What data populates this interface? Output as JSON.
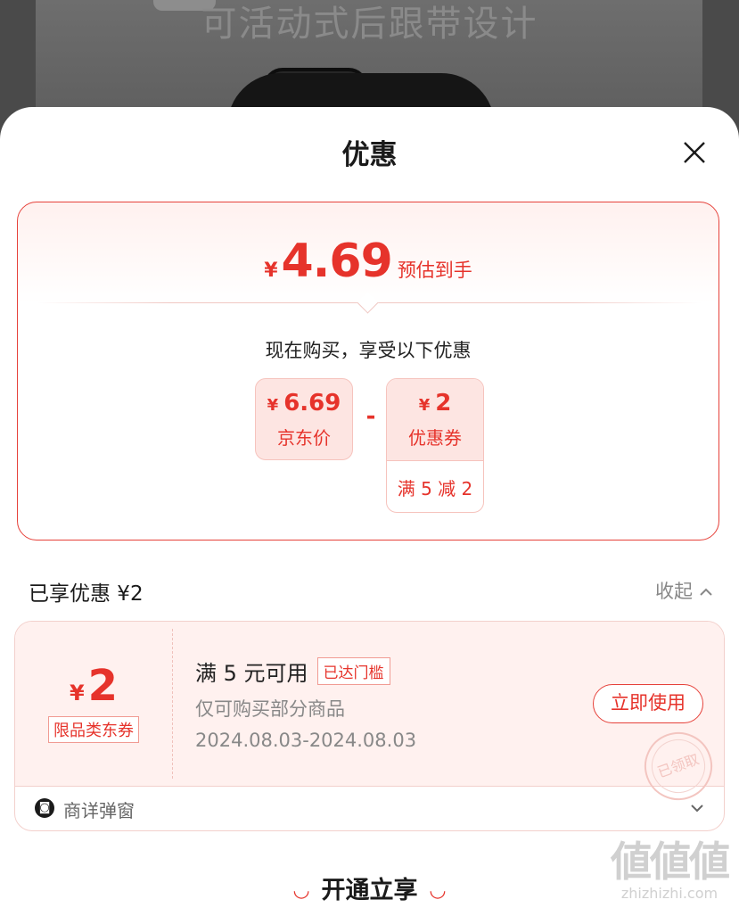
{
  "background": {
    "caption": "可活动式后跟带设计"
  },
  "sheet": {
    "title": "优惠",
    "close_icon": "close-icon"
  },
  "summary": {
    "currency": "¥",
    "estimated_price": "4.69",
    "estimated_label": "预估到手",
    "buy_text": "现在购买，享受以下优惠",
    "price_box": {
      "currency": "¥",
      "value": "6.69",
      "label": "京东价"
    },
    "operator": "-",
    "coupon_box": {
      "currency": "¥",
      "value": "2",
      "label": "优惠券",
      "condition": "满 5 减 2"
    }
  },
  "enjoyed": {
    "title": "已享优惠 ¥2",
    "collapse_label": "收起",
    "collapse_icon": "chevron-up-icon"
  },
  "coupon": {
    "currency": "¥",
    "value": "2",
    "tag": "限品类东券",
    "condition": "满 5 元可用",
    "badge": "已达门槛",
    "scope": "仅可购买部分商品",
    "date_range": "2024.08.03-2024.08.03",
    "use_button": "立即使用",
    "stamp_text": "已领取",
    "source_label": "商详弹窗",
    "source_icon": "jd-logo-icon",
    "expand_icon": "chevron-down-icon"
  },
  "bottom": {
    "button_label": "开通立享"
  },
  "watermark": {
    "main": "値値値",
    "site": "zhizhizhi.com"
  },
  "colors": {
    "accent": "#e6332b",
    "tint": "#fde5e2"
  }
}
